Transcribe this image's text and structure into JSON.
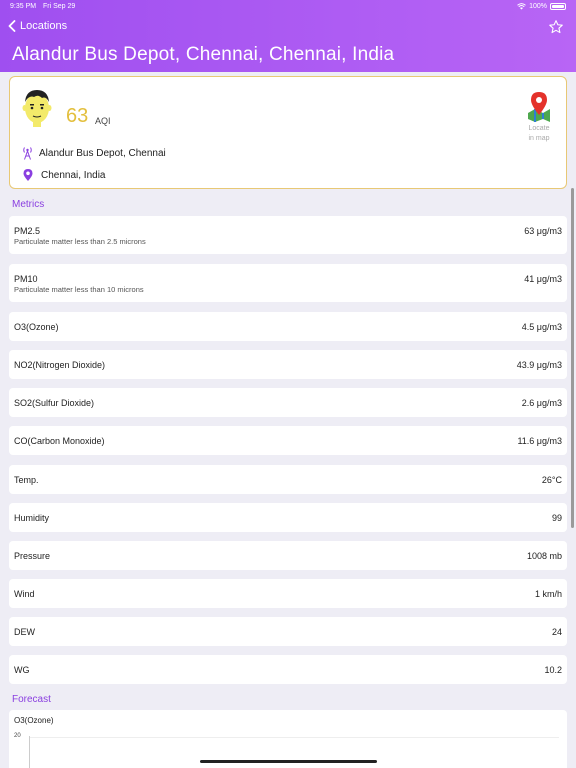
{
  "status_bar": {
    "time": "9:35 PM",
    "date": "Fri Sep 29",
    "battery": "100%"
  },
  "nav": {
    "back_label": "Locations",
    "title": "Alandur Bus Depot, Chennai, Chennai, India"
  },
  "summary": {
    "aqi_value": "63",
    "aqi_label": "AQI",
    "station": "Alandur Bus Depot, Chennai",
    "city": "Chennai, India",
    "map_label_line1": "Locate",
    "map_label_line2": "in map"
  },
  "metrics_title": "Metrics",
  "metrics": [
    {
      "name": "PM2.5",
      "desc": "Particulate matter less than 2.5 microns",
      "value": "63 μg/m3"
    },
    {
      "name": "PM10",
      "desc": "Particulate matter less than 10 microns",
      "value": "41 μg/m3"
    },
    {
      "name": "O3(Ozone)",
      "value": "4.5 μg/m3"
    },
    {
      "name": "NO2(Nitrogen Dioxide)",
      "value": "43.9 μg/m3"
    },
    {
      "name": "SO2(Sulfur Dioxide)",
      "value": "2.6 μg/m3"
    },
    {
      "name": "CO(Carbon Monoxide)",
      "value": "11.6 μg/m3"
    },
    {
      "name": "Temp.",
      "value": "26°C"
    },
    {
      "name": "Humidity",
      "value": "99"
    },
    {
      "name": "Pressure",
      "value": "1008 mb"
    },
    {
      "name": "Wind",
      "value": "1 km/h"
    },
    {
      "name": "DEW",
      "value": "24"
    },
    {
      "name": "WG",
      "value": "10.2"
    }
  ],
  "forecast_title": "Forecast",
  "forecast": {
    "label": "O3(Ozone)",
    "tick": "20"
  },
  "colors": {
    "header": "#a653f2",
    "accent": "#8a3fe0",
    "aqi": "#e3bf3d"
  },
  "icons": {
    "back": "chevron-left-icon",
    "favorite": "star-outline-icon",
    "map": "map-pin-icon",
    "station": "antenna-icon",
    "location": "location-pin-icon"
  }
}
